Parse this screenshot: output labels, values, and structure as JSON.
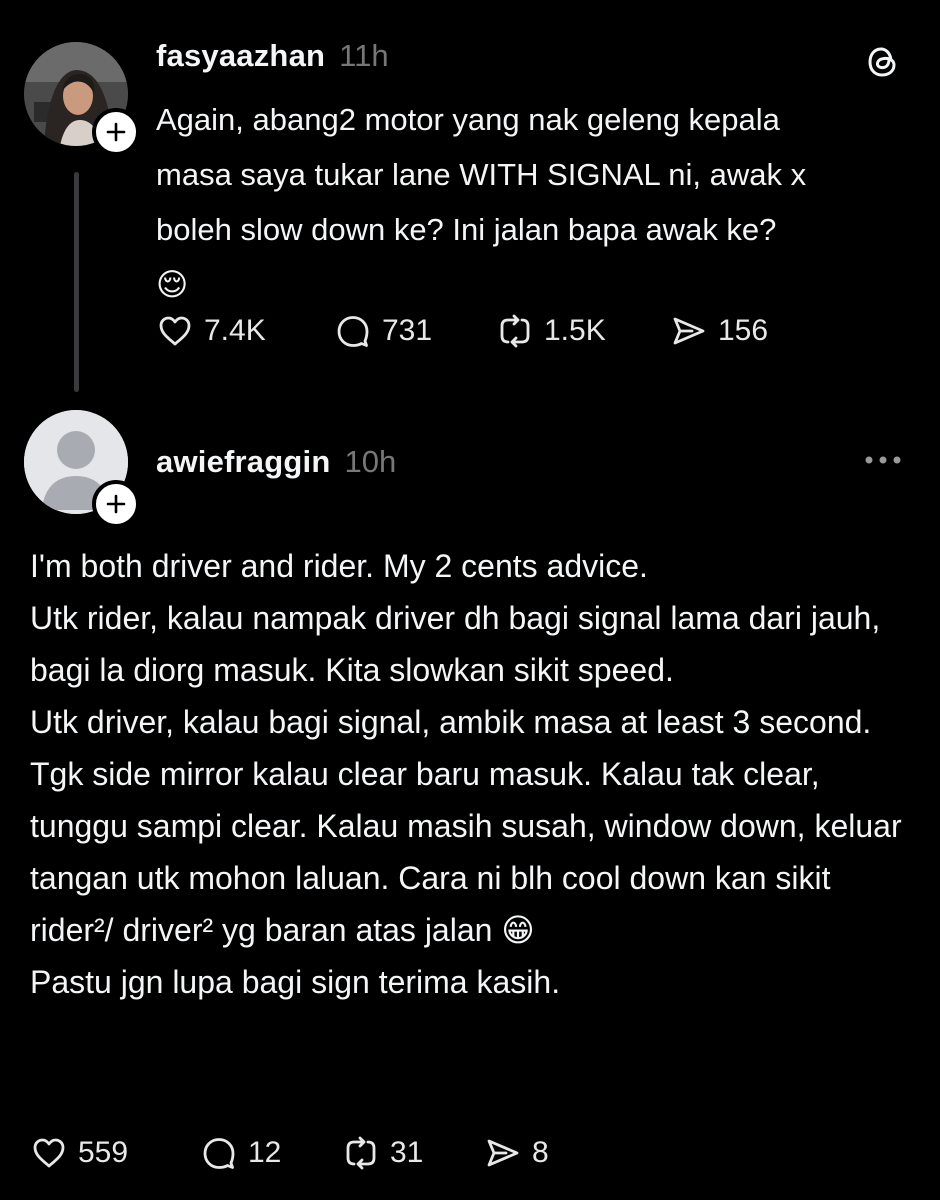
{
  "post1": {
    "username": "fasyaazhan",
    "time": "11h",
    "lines": [
      "Again, abang2 motor yang nak geleng kepala",
      "masa saya tukar lane WITH SIGNAL ni, awak x",
      "boleh slow down ke? Ini jalan bapa awak ke?",
      "😌"
    ],
    "likes": "7.4K",
    "replies": "731",
    "reposts": "1.5K",
    "shares": "156"
  },
  "post2": {
    "username": "awiefraggin",
    "time": "10h",
    "paragraphs": [
      "I'm both driver and rider. My 2 cents advice.",
      "Utk rider, kalau nampak driver dh bagi signal lama dari jauh, bagi la diorg masuk. Kita slowkan sikit speed.",
      "Utk driver, kalau bagi signal, ambik masa at least 3 second. Tgk side mirror kalau clear baru masuk. Kalau tak clear, tunggu sampi clear. Kalau masih susah, window down, keluar tangan utk mohon laluan. Cara ni blh cool down kan sikit rider²/ driver² yg baran atas jalan 😁",
      "Pastu jgn lupa bagi sign terima kasih."
    ],
    "likes": "559",
    "replies": "12",
    "reposts": "31",
    "shares": "8"
  },
  "icons": {
    "like": "heart-icon",
    "reply": "comment-icon",
    "repost": "repost-icon",
    "share": "send-icon",
    "brand": "threads-logo",
    "more": "more-options-icon",
    "follow": "plus-icon"
  },
  "colors": {
    "background": "#000000",
    "text": "#f3f5f7",
    "muted": "#777777",
    "thread_line": "#3a3a3c"
  }
}
